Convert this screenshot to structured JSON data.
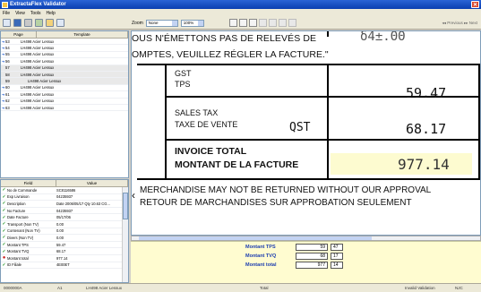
{
  "window": {
    "title": "ExtractaFlex Validator",
    "close_glyph": "✕"
  },
  "menu": [
    "File",
    "View",
    "Tools",
    "Help"
  ],
  "toolbar": {
    "zoom_label": "Zoom",
    "zoom_select": "None",
    "percent_select": "100%",
    "nav_text": "◂◂ Previous ▸▸ Next"
  },
  "pages_panel": {
    "columns": [
      "Page",
      "Template"
    ],
    "rows": [
      {
        "page": "53",
        "template": "LH498 Acier Lessux",
        "arrow": true
      },
      {
        "page": "54",
        "template": "LH498 Acier Lessux",
        "arrow": true
      },
      {
        "page": "55",
        "template": "LH498 Acier Lessux",
        "arrow": true
      },
      {
        "page": "56",
        "template": "LH498 Acier Lessux",
        "arrow": true
      },
      {
        "page": "57",
        "template": "LH498 Acier Lessux",
        "arrow": false
      },
      {
        "page": "58",
        "template": "LH498 Acier Lessux",
        "arrow": false
      },
      {
        "page": "59",
        "template": "LH498 Acier Lessux",
        "arrow": false,
        "sub": true
      },
      {
        "page": "60",
        "template": "LH498 Acier Lessux",
        "arrow": true
      },
      {
        "page": "61",
        "template": "LH498 Acier Lessux",
        "arrow": true
      },
      {
        "page": "62",
        "template": "LH498 Acier Lessux",
        "arrow": true
      },
      {
        "page": "63",
        "template": "LH498 Acier Lessux",
        "arrow": true
      }
    ]
  },
  "fields_panel": {
    "columns": [
      "Field",
      "Value"
    ],
    "rows": [
      {
        "field": "No de Commande",
        "value": "SC8116586",
        "ok": true
      },
      {
        "field": "Exp Livraison",
        "value": "04235937",
        "ok": true
      },
      {
        "field": "Description",
        "value": "Date 2006/05/17 Qty 10.63 CG...",
        "ok": true
      },
      {
        "field": "No Facture",
        "value": "04235937",
        "ok": true
      },
      {
        "field": "Date Facture",
        "value": "05/17/06",
        "ok": true
      },
      {
        "field": "Transport (Non TV)",
        "value": "0.00",
        "ok": true
      },
      {
        "field": "Contenant (Non TV)",
        "value": "0.00",
        "ok": true
      },
      {
        "field": "Divers (Non TV)",
        "value": "0.00",
        "ok": true
      },
      {
        "field": "Montant TPS",
        "value": "59.47",
        "ok": true
      },
      {
        "field": "Montant TVQ",
        "value": "68.17",
        "ok": true
      },
      {
        "field": "Montant total",
        "value": "977.14",
        "ok": false
      },
      {
        "field": "ID Filiale",
        "value": "4E00ET",
        "ok": true
      }
    ]
  },
  "document": {
    "line1": "OUS N'ÉMETTONS PAS DE RELEVÉS DE",
    "line2": "OMPTES, VEUILLEZ RÉGLER LA FACTURE.\"",
    "top_numbers": "δ4±.ΘΘ",
    "gst_label": "GST",
    "tps_label": "TPS",
    "gst_value": "59.47",
    "sales_tax_label": "SALES TAX",
    "taxe_vente_label": "TAXE DE VENTE",
    "qst_label": "QST",
    "qst_value": "68.17",
    "invoice_total_label": "INVOICE TOTAL",
    "montant_label": "MONTANT DE LA FACTURE",
    "total_value": "977.14",
    "merch_line1": "MERCHANDISE MAY NOT BE RETURNED WITHOUT OUR APPROVAL",
    "merch_line2": "RETOUR DE MARCHANDISES SUR APPROBATION SEULEMENT"
  },
  "field_entry": [
    {
      "label": "Montant TPS",
      "value": "59",
      "cents": "47"
    },
    {
      "label": "Montant TVQ",
      "value": "68",
      "cents": "17"
    },
    {
      "label": "Montant total",
      "value": "977",
      "cents": "14"
    }
  ],
  "status": {
    "doc_id": "0000000A",
    "count": "A1",
    "template": "LH498 Acier Lessux",
    "field": "Total",
    "mode": "Invalid Validation",
    "caps": "NJC"
  }
}
